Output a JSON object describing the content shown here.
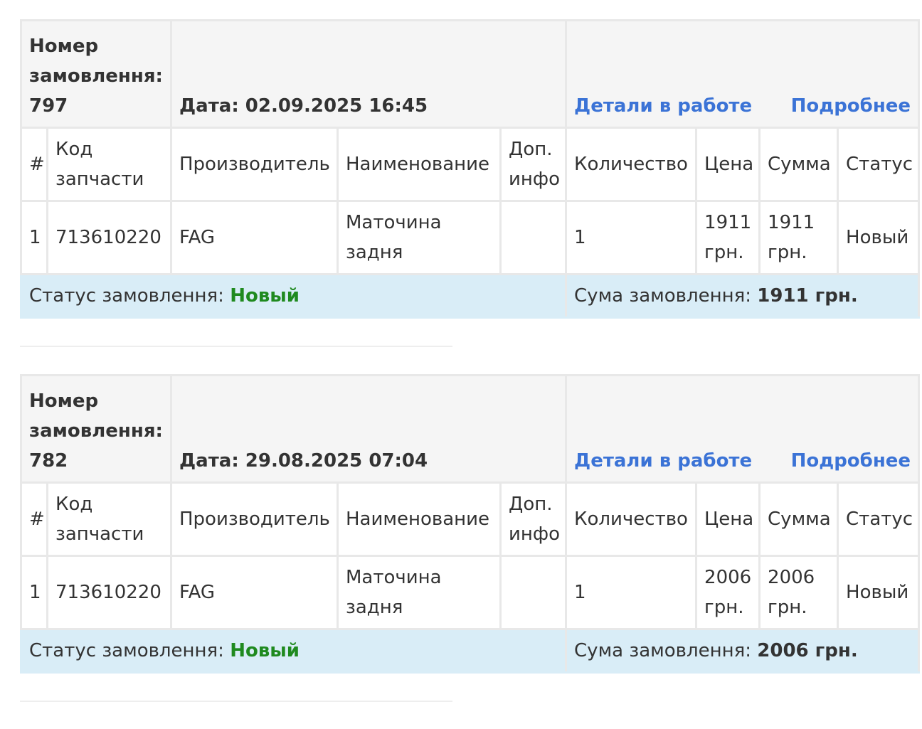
{
  "orders": [
    {
      "order_number_label": "Номер замовлення:",
      "order_number": "797",
      "date_label": "Дата:",
      "date": "02.09.2025 16:45",
      "status_link": "Детали в работе",
      "details_link": "Подробнее",
      "columns": [
        "#",
        "Код запчасти",
        "Производитель",
        "Наименование",
        "Доп. инфо",
        "Количество",
        "Цена",
        "Сумма",
        "Статус"
      ],
      "items": [
        {
          "index": "1",
          "code": "713610220",
          "manufacturer": "FAG",
          "name": "Маточина задня",
          "extra": "",
          "quantity": "1",
          "price": "1911 грн.",
          "sum": "1911 грн.",
          "status": "Новый"
        }
      ],
      "footer": {
        "status_label": "Статус замовлення:",
        "status_value": "Новый",
        "total_label": "Сума замовлення:",
        "total_value": "1911 грн."
      }
    },
    {
      "order_number_label": "Номер замовлення:",
      "order_number": "782",
      "date_label": "Дата:",
      "date": "29.08.2025 07:04",
      "status_link": "Детали в работе",
      "details_link": "Подробнее",
      "columns": [
        "#",
        "Код запчасти",
        "Производитель",
        "Наименование",
        "Доп. инфо",
        "Количество",
        "Цена",
        "Сумма",
        "Статус"
      ],
      "items": [
        {
          "index": "1",
          "code": "713610220",
          "manufacturer": "FAG",
          "name": "Маточина задня",
          "extra": "",
          "quantity": "1",
          "price": "2006 грн.",
          "sum": "2006 грн.",
          "status": "Новый"
        }
      ],
      "footer": {
        "status_label": "Статус замовлення:",
        "status_value": "Новый",
        "total_label": "Сума замовлення:",
        "total_value": "2006 грн."
      }
    }
  ],
  "colors": {
    "link": "#3b73d6",
    "status_ok": "#1f8a1f",
    "footer_bg": "#d9edf7",
    "header_bg": "#f5f5f5"
  }
}
